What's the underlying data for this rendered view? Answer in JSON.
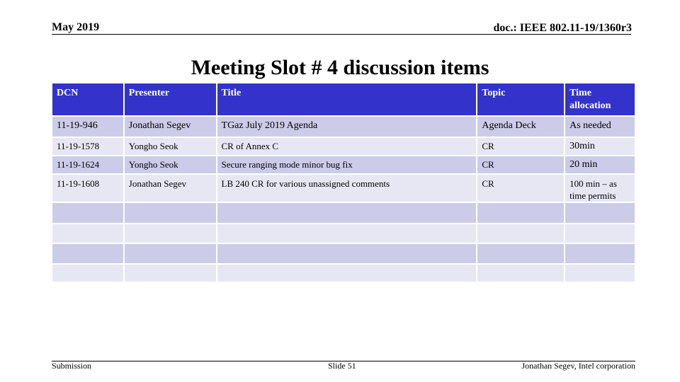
{
  "header": {
    "date": "May 2019",
    "doc_id": "doc.: IEEE 802.11-19/1360r3"
  },
  "title": "Meeting Slot # 4 discussion items",
  "table": {
    "columns": [
      "DCN",
      "Presenter",
      "Title",
      "Topic",
      "Time allocation"
    ],
    "rows": [
      {
        "dcn": "11-19-946",
        "presenter": "Jonathan Segev",
        "title": "TGaz July 2019 Agenda",
        "topic": "Agenda Deck",
        "time": "As needed"
      },
      {
        "dcn": "11-19-1578",
        "presenter": "Yongho Seok",
        "title": "CR of Annex C",
        "topic": "CR",
        "time": "30min"
      },
      {
        "dcn": "11-19-1624",
        "presenter": "Yongho Seok",
        "title": "Secure ranging mode minor bug fix",
        "topic": "CR",
        "time": "20 min"
      },
      {
        "dcn": "11-19-1608",
        "presenter": "Jonathan Segev",
        "title": "LB 240 CR for various unassigned comments",
        "topic": "CR",
        "time": "100 min – as time permits"
      },
      {
        "dcn": "",
        "presenter": "",
        "title": "",
        "topic": "",
        "time": ""
      },
      {
        "dcn": "",
        "presenter": "",
        "title": "",
        "topic": "",
        "time": ""
      },
      {
        "dcn": "",
        "presenter": "",
        "title": "",
        "topic": "",
        "time": ""
      },
      {
        "dcn": "",
        "presenter": "",
        "title": "",
        "topic": "",
        "time": ""
      }
    ]
  },
  "footer": {
    "left": "Submission",
    "center": "Slide 51",
    "right": "Jonathan Segev, Intel corporation"
  },
  "colors": {
    "header_fill": "#3333cc",
    "row_odd": "#cccce9",
    "row_even": "#e7e7f4"
  }
}
